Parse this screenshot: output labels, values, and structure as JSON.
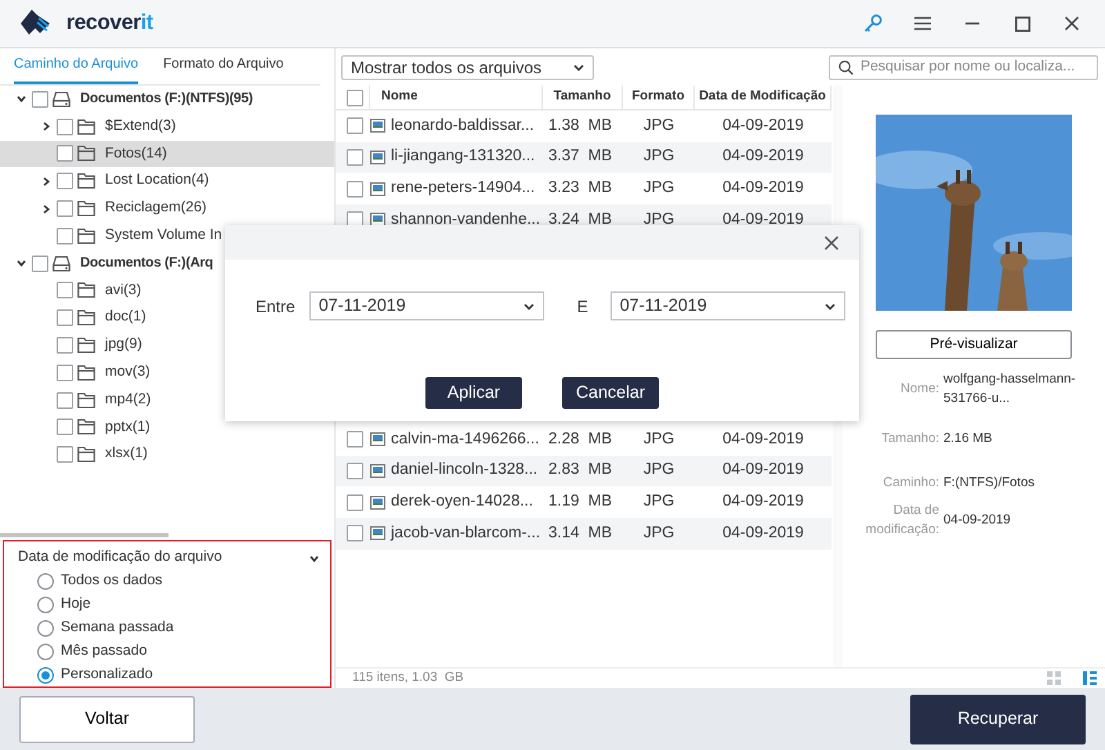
{
  "window": {
    "logo": {
      "main": "recover",
      "accent": "it"
    }
  },
  "sidebar": {
    "tabs": [
      {
        "label": "Caminho do Arquivo",
        "selected": true
      },
      {
        "label": "Formato do Arquivo",
        "selected": false
      }
    ],
    "tree": [
      {
        "label": "Documentos (F:)(NTFS)(95)",
        "kind": "drive",
        "expanded": true,
        "checked": false,
        "selected": false,
        "children": [
          {
            "label": "$Extend(3)",
            "kind": "folder",
            "expanded": false,
            "checked": false,
            "selected": false
          },
          {
            "label": "Fotos(14)",
            "kind": "folder",
            "checked": false,
            "selected": true
          },
          {
            "label": "Lost Location(4)",
            "kind": "folder",
            "expanded": false,
            "checked": false,
            "selected": false
          },
          {
            "label": "Reciclagem(26)",
            "kind": "folder",
            "expanded": false,
            "checked": false,
            "selected": false
          },
          {
            "label": "System Volume In",
            "kind": "folder",
            "checked": false,
            "selected": false
          }
        ]
      },
      {
        "label": "Documentos (F:)(Arq",
        "kind": "drive",
        "expanded": true,
        "checked": false,
        "selected": false,
        "children": [
          {
            "label": "avi(3)",
            "kind": "folder",
            "checked": false,
            "selected": false
          },
          {
            "label": "doc(1)",
            "kind": "folder",
            "checked": false,
            "selected": false
          },
          {
            "label": "jpg(9)",
            "kind": "folder",
            "checked": false,
            "selected": false
          },
          {
            "label": "mov(3)",
            "kind": "folder",
            "checked": false,
            "selected": false
          },
          {
            "label": "mp4(2)",
            "kind": "folder",
            "checked": false,
            "selected": false
          },
          {
            "label": "pptx(1)",
            "kind": "folder",
            "checked": false,
            "selected": false
          },
          {
            "label": "xlsx(1)",
            "kind": "folder",
            "checked": false,
            "selected": false
          }
        ]
      }
    ],
    "filter": {
      "title": "Data de modificação do arquivo",
      "expanded": true,
      "options": [
        {
          "label": "Todos os dados",
          "selected": false
        },
        {
          "label": "Hoje",
          "selected": false
        },
        {
          "label": "Semana passada",
          "selected": false
        },
        {
          "label": "Mês passado",
          "selected": false
        },
        {
          "label": "Personalizado",
          "selected": true
        }
      ]
    }
  },
  "toolbar": {
    "view_filter": "Mostrar todos os arquivos",
    "search": {
      "placeholder": "Pesquisar por nome ou localiza..."
    }
  },
  "table": {
    "select_all_checked": false,
    "columns": [
      "Nome",
      "Tamanho",
      "Formato",
      "Data de Modificação"
    ],
    "rows_before_dialog": [
      {
        "name": "leonardo-baldissar...",
        "size": "1.38  MB",
        "format": "JPG",
        "date": "04-09-2019",
        "checked": false
      },
      {
        "name": "li-jiangang-131320...",
        "size": "3.37  MB",
        "format": "JPG",
        "date": "04-09-2019",
        "checked": false
      },
      {
        "name": "rene-peters-14904...",
        "size": "3.23  MB",
        "format": "JPG",
        "date": "04-09-2019",
        "checked": false
      },
      {
        "name": "shannon-vandenhe...",
        "size": "3.24  MB",
        "format": "JPG",
        "date": "04-09-2019",
        "checked": false
      }
    ],
    "rows_after_dialog": [
      {
        "name": "calvin-ma-1496266...",
        "size": "2.28  MB",
        "format": "JPG",
        "date": "04-09-2019",
        "checked": false
      },
      {
        "name": "daniel-lincoln-1328...",
        "size": "2.83  MB",
        "format": "JPG",
        "date": "04-09-2019",
        "checked": false
      },
      {
        "name": "derek-oyen-14028...",
        "size": "1.19  MB",
        "format": "JPG",
        "date": "04-09-2019",
        "checked": false
      },
      {
        "name": "jacob-van-blarcom-...",
        "size": "3.14  MB",
        "format": "JPG",
        "date": "04-09-2019",
        "checked": false
      }
    ]
  },
  "preview": {
    "button": "Pré-visualizar",
    "details": [
      {
        "label": "Nome:",
        "value": "wolfgang-hasselmann-531766-u..."
      },
      {
        "label": "Tamanho:",
        "value": "2.16  MB"
      },
      {
        "label": "Caminho:",
        "value": "F:(NTFS)/Fotos"
      },
      {
        "label": "Data de modificação:",
        "value": "04-09-2019"
      }
    ]
  },
  "status_bar": {
    "summary": "115 itens, 1.03  GB",
    "view_modes": [
      {
        "kind": "grid",
        "selected": false
      },
      {
        "kind": "list",
        "selected": true
      }
    ]
  },
  "dialog": {
    "from_label": "Entre",
    "from_value": "07-11-2019",
    "to_label": "E",
    "to_value": "07-11-2019",
    "buttons": [
      "Aplicar",
      "Cancelar"
    ]
  },
  "footer": {
    "back": "Voltar",
    "recover": "Recuperar"
  }
}
